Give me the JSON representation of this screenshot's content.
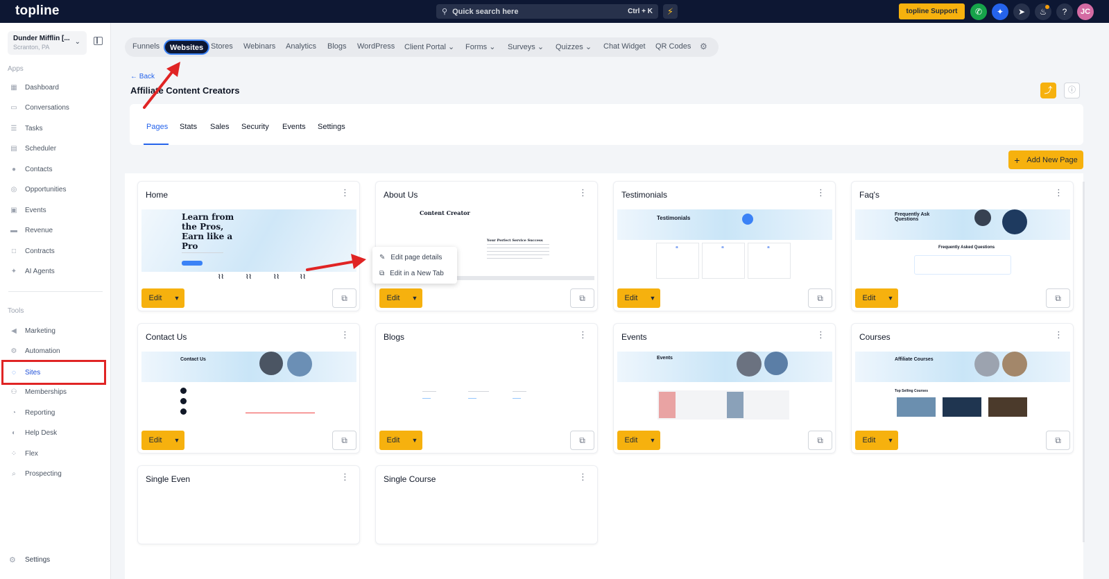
{
  "topbar": {
    "logo": "topline",
    "search_placeholder": "Quick search here",
    "search_shortcut": "Ctrl + K",
    "support_label": "topline Support",
    "avatar_initials": "JC"
  },
  "sidebar": {
    "account_name": "Dunder Mifflin [...",
    "account_location": "Scranton, PA",
    "apps_label": "Apps",
    "apps": [
      {
        "label": "Dashboard",
        "icon": "dashboard-icon"
      },
      {
        "label": "Conversations",
        "icon": "chat-icon"
      },
      {
        "label": "Tasks",
        "icon": "tasks-icon"
      },
      {
        "label": "Scheduler",
        "icon": "calendar-icon"
      },
      {
        "label": "Contacts",
        "icon": "person-icon"
      },
      {
        "label": "Opportunities",
        "icon": "target-icon"
      },
      {
        "label": "Events",
        "icon": "events-icon"
      },
      {
        "label": "Revenue",
        "icon": "card-icon"
      },
      {
        "label": "Contracts",
        "icon": "document-icon"
      },
      {
        "label": "AI Agents",
        "icon": "sparkle-icon"
      }
    ],
    "tools_label": "Tools",
    "tools": [
      {
        "label": "Marketing",
        "icon": "megaphone-icon"
      },
      {
        "label": "Automation",
        "icon": "gears-icon"
      },
      {
        "label": "Sites",
        "icon": "globe-icon"
      },
      {
        "label": "Memberships",
        "icon": "members-icon"
      },
      {
        "label": "Reporting",
        "icon": "pie-icon"
      },
      {
        "label": "Help Desk",
        "icon": "help-icon"
      },
      {
        "label": "Flex",
        "icon": "flex-icon"
      },
      {
        "label": "Prospecting",
        "icon": "search-icon"
      }
    ],
    "settings_label": "Settings"
  },
  "product_tabs": [
    {
      "label": "Funnels"
    },
    {
      "label": "Websites",
      "active": true
    },
    {
      "label": "Stores"
    },
    {
      "label": "Webinars"
    },
    {
      "label": "Analytics"
    },
    {
      "label": "Blogs"
    },
    {
      "label": "WordPress"
    },
    {
      "label": "Client Portal",
      "dropdown": true
    },
    {
      "label": "Forms",
      "dropdown": true
    },
    {
      "label": "Surveys",
      "dropdown": true
    },
    {
      "label": "Quizzes",
      "dropdown": true
    },
    {
      "label": "Chat Widget"
    },
    {
      "label": "QR Codes"
    }
  ],
  "page": {
    "back_label": "Back",
    "title": "Affiliate Content Creators",
    "add_page_label": "Add New Page"
  },
  "sub_tabs": [
    {
      "label": "Pages",
      "active": true
    },
    {
      "label": "Stats"
    },
    {
      "label": "Sales"
    },
    {
      "label": "Security"
    },
    {
      "label": "Events"
    },
    {
      "label": "Settings"
    }
  ],
  "cards": [
    {
      "name": "Home",
      "has_actions": true,
      "thumb": "home"
    },
    {
      "name": "About Us",
      "has_actions": true,
      "thumb": "about"
    },
    {
      "name": "Testimonials",
      "has_actions": true,
      "thumb": "testimonials"
    },
    {
      "name": "Faq's",
      "has_actions": true,
      "thumb": "faq"
    },
    {
      "name": "Contact Us",
      "has_actions": true,
      "thumb": "contact"
    },
    {
      "name": "Blogs",
      "has_actions": true,
      "thumb": "blogs"
    },
    {
      "name": "Events",
      "has_actions": true,
      "thumb": "events"
    },
    {
      "name": "Courses",
      "has_actions": true,
      "thumb": "courses"
    },
    {
      "name": "Single Even",
      "has_actions": false,
      "thumb": "blank"
    },
    {
      "name": "Single Course",
      "has_actions": false,
      "thumb": "blank"
    }
  ],
  "card_edit_label": "Edit",
  "thumb_text": {
    "home_heading": "Learn from the Pros, Earn like a Pro",
    "about_heading": "Content Creator",
    "about_sub": "Your Perfect Service Success",
    "testimonials_heading": "Testimonials",
    "faq_heading": "Frequently Ask Questions",
    "faq_sub": "Frequently Asked Questions",
    "contact_heading": "Contact Us",
    "events_heading": "Events",
    "courses_heading": "Affiliate Courses",
    "courses_sub": "Top Selling Courses"
  },
  "popup_menu": {
    "items": [
      {
        "label": "Edit page details",
        "icon": "pencil-icon"
      },
      {
        "label": "Edit in a New Tab",
        "icon": "edit-external-icon"
      }
    ]
  },
  "colors": {
    "accent": "#f6b10e",
    "topbar": "#0d1733",
    "link": "#2563eb",
    "annotation": "#e02424"
  }
}
